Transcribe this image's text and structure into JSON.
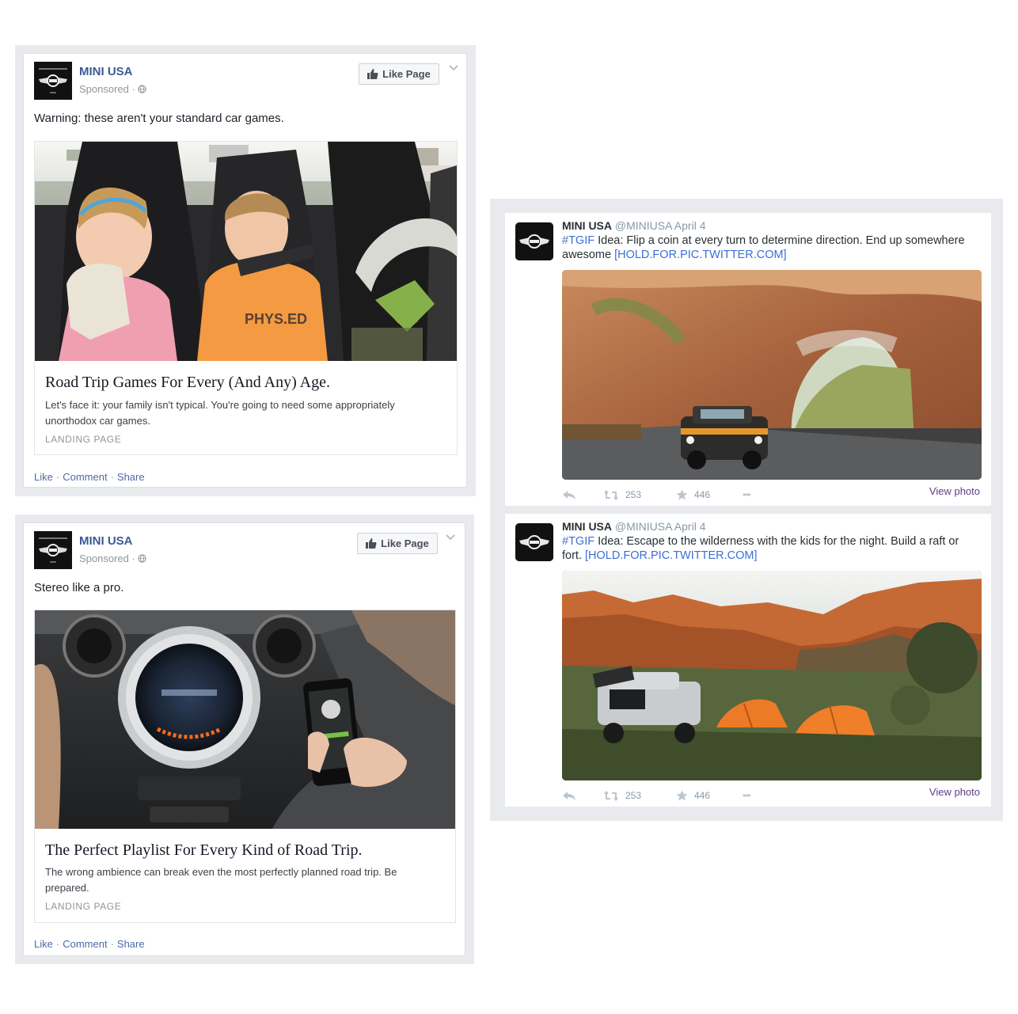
{
  "facebook_posts": [
    {
      "page_name": "MINI USA",
      "sponsored": "Sponsored ·",
      "like_page": "Like Page",
      "message": "Warning: these aren't your standard car games.",
      "link_title": "Road Trip Games For Every (And Any) Age.",
      "link_description": "Let's face it: your family isn't typical. You're going to need some appropriately unorthodox car games.",
      "link_caption": "LANDING PAGE",
      "shirt_text": "PHYS.ED",
      "actions": {
        "like": "Like",
        "comment": "Comment",
        "share": "Share"
      }
    },
    {
      "page_name": "MINI USA",
      "sponsored": "Sponsored ·",
      "like_page": "Like Page",
      "message": "Stereo like a pro.",
      "link_title": "The Perfect Playlist For Every Kind of Road Trip.",
      "link_description": "The wrong ambience can break even the most perfectly planned road trip. Be prepared.",
      "link_caption": "LANDING PAGE",
      "actions": {
        "like": "Like",
        "comment": "Comment",
        "share": "Share"
      }
    }
  ],
  "tweets": [
    {
      "name": "MINI USA",
      "handle": "@MINIUSA",
      "date": "April 4",
      "hashtag": "#TGIF",
      "text": " Idea: Flip a coin at every turn to determine direction. End up somewhere awesome ",
      "link": "[HOLD.FOR.PIC.TWITTER.COM]",
      "retweets": "253",
      "favorites": "446",
      "more": "•••",
      "view_photo": "View photo"
    },
    {
      "name": "MINI USA",
      "handle": "@MINIUSA",
      "date": "April 4",
      "hashtag": "#TGIF",
      "text": " Idea: Escape to the wilderness with the kids for the night. Build a raft or fort. ",
      "link": "[HOLD.FOR.PIC.TWITTER.COM]",
      "retweets": "253",
      "favorites": "446",
      "more": "•••",
      "view_photo": "View photo"
    }
  ],
  "icons": {
    "brand_logo": "mini-wings-logo-icon",
    "like_page": "thumbs-up-icon",
    "audience": "globe-icon",
    "menu": "chevron-down-icon",
    "reply": "reply-icon",
    "retweet": "retweet-icon",
    "favorite": "star-icon",
    "more": "more-dots-icon"
  },
  "colors": {
    "facebook_blue": "#3b5998",
    "frame_gray": "#e9eaed",
    "twitter_link": "#3b6fd6",
    "view_photo": "#5a3f88"
  }
}
